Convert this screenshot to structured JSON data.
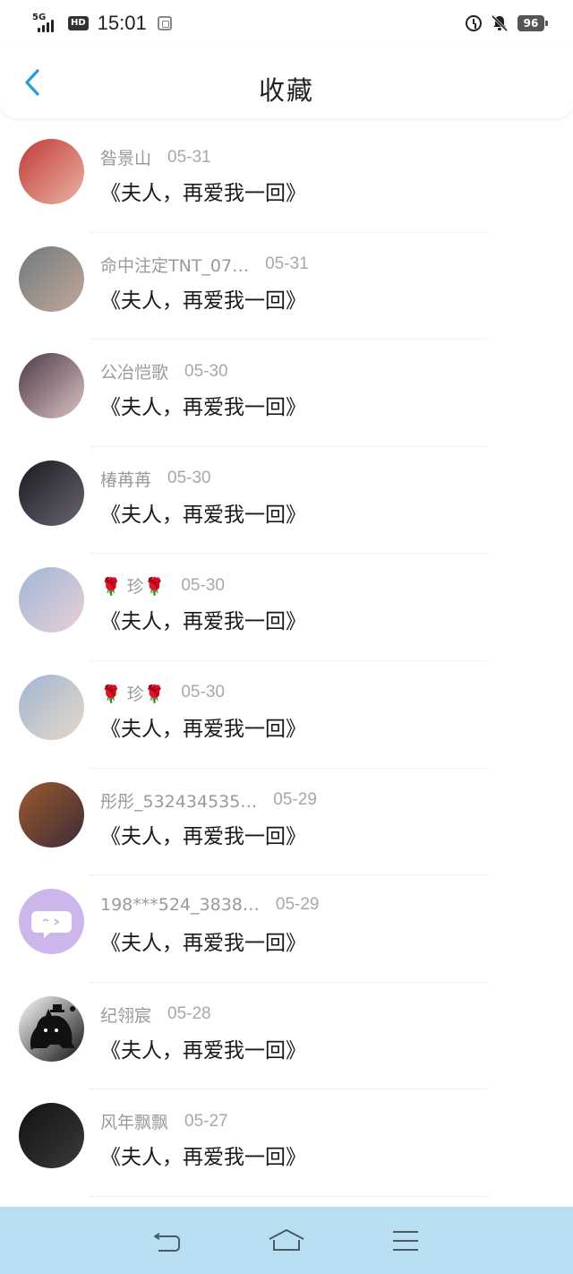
{
  "status": {
    "network": "5G",
    "hd": "HD",
    "time": "15:01",
    "battery": "96",
    "icons": [
      "signal-icon",
      "hd-icon",
      "app-notification-icon",
      "alarm-icon",
      "mute-bell-icon",
      "battery-icon"
    ]
  },
  "header": {
    "title": "收藏",
    "back_icon": "chevron-left-icon",
    "accent": "#2b9bd8"
  },
  "items": [
    {
      "name": "昝景山",
      "date": "05-31",
      "title": "《夫人，再爱我一回》",
      "avatar_colors": [
        "#c23a3a",
        "#e9b3a0"
      ]
    },
    {
      "name": "命中注定TNT_07…",
      "date": "05-31",
      "title": "《夫人，再爱我一回》",
      "avatar_colors": [
        "#6f7a7c",
        "#c4a79a"
      ]
    },
    {
      "name": "公冶恺歌",
      "date": "05-30",
      "title": "《夫人，再爱我一回》",
      "avatar_colors": [
        "#4a3a48",
        "#dcc1c4"
      ]
    },
    {
      "name": "椿苒苒",
      "date": "05-30",
      "title": "《夫人，再爱我一回》",
      "avatar_colors": [
        "#1a1a1f",
        "#6a6470"
      ]
    },
    {
      "name": "🌹 珍🌹",
      "date": "05-30",
      "title": "《夫人，再爱我一回》",
      "avatar_colors": [
        "#9fb7d6",
        "#e9cfd6"
      ]
    },
    {
      "name": "🌹 珍🌹",
      "date": "05-30",
      "title": "《夫人，再爱我一回》",
      "avatar_colors": [
        "#9fb7d6",
        "#e7d7c6"
      ]
    },
    {
      "name": "彤彤_532434535…",
      "date": "05-29",
      "title": "《夫人，再爱我一回》",
      "avatar_colors": [
        "#9c5a2e",
        "#3c2c36"
      ]
    },
    {
      "name": "198***524_3838…",
      "date": "05-29",
      "title": "《夫人，再爱我一回》",
      "avatar_colors": [
        "#cdb6ec",
        "#cdb6ec"
      ]
    },
    {
      "name": "纪翎宸",
      "date": "05-28",
      "title": "《夫人，再爱我一回》",
      "avatar_colors": [
        "#ffffff",
        "#111111"
      ]
    },
    {
      "name": "风年飘飘",
      "date": "05-27",
      "title": "《夫人，再爱我一回》",
      "avatar_colors": [
        "#111111",
        "#3a3a3a"
      ]
    }
  ],
  "navbar": {
    "background": "#b8dff1",
    "buttons": [
      "back-nav-icon",
      "home-nav-icon",
      "menu-nav-icon"
    ]
  }
}
